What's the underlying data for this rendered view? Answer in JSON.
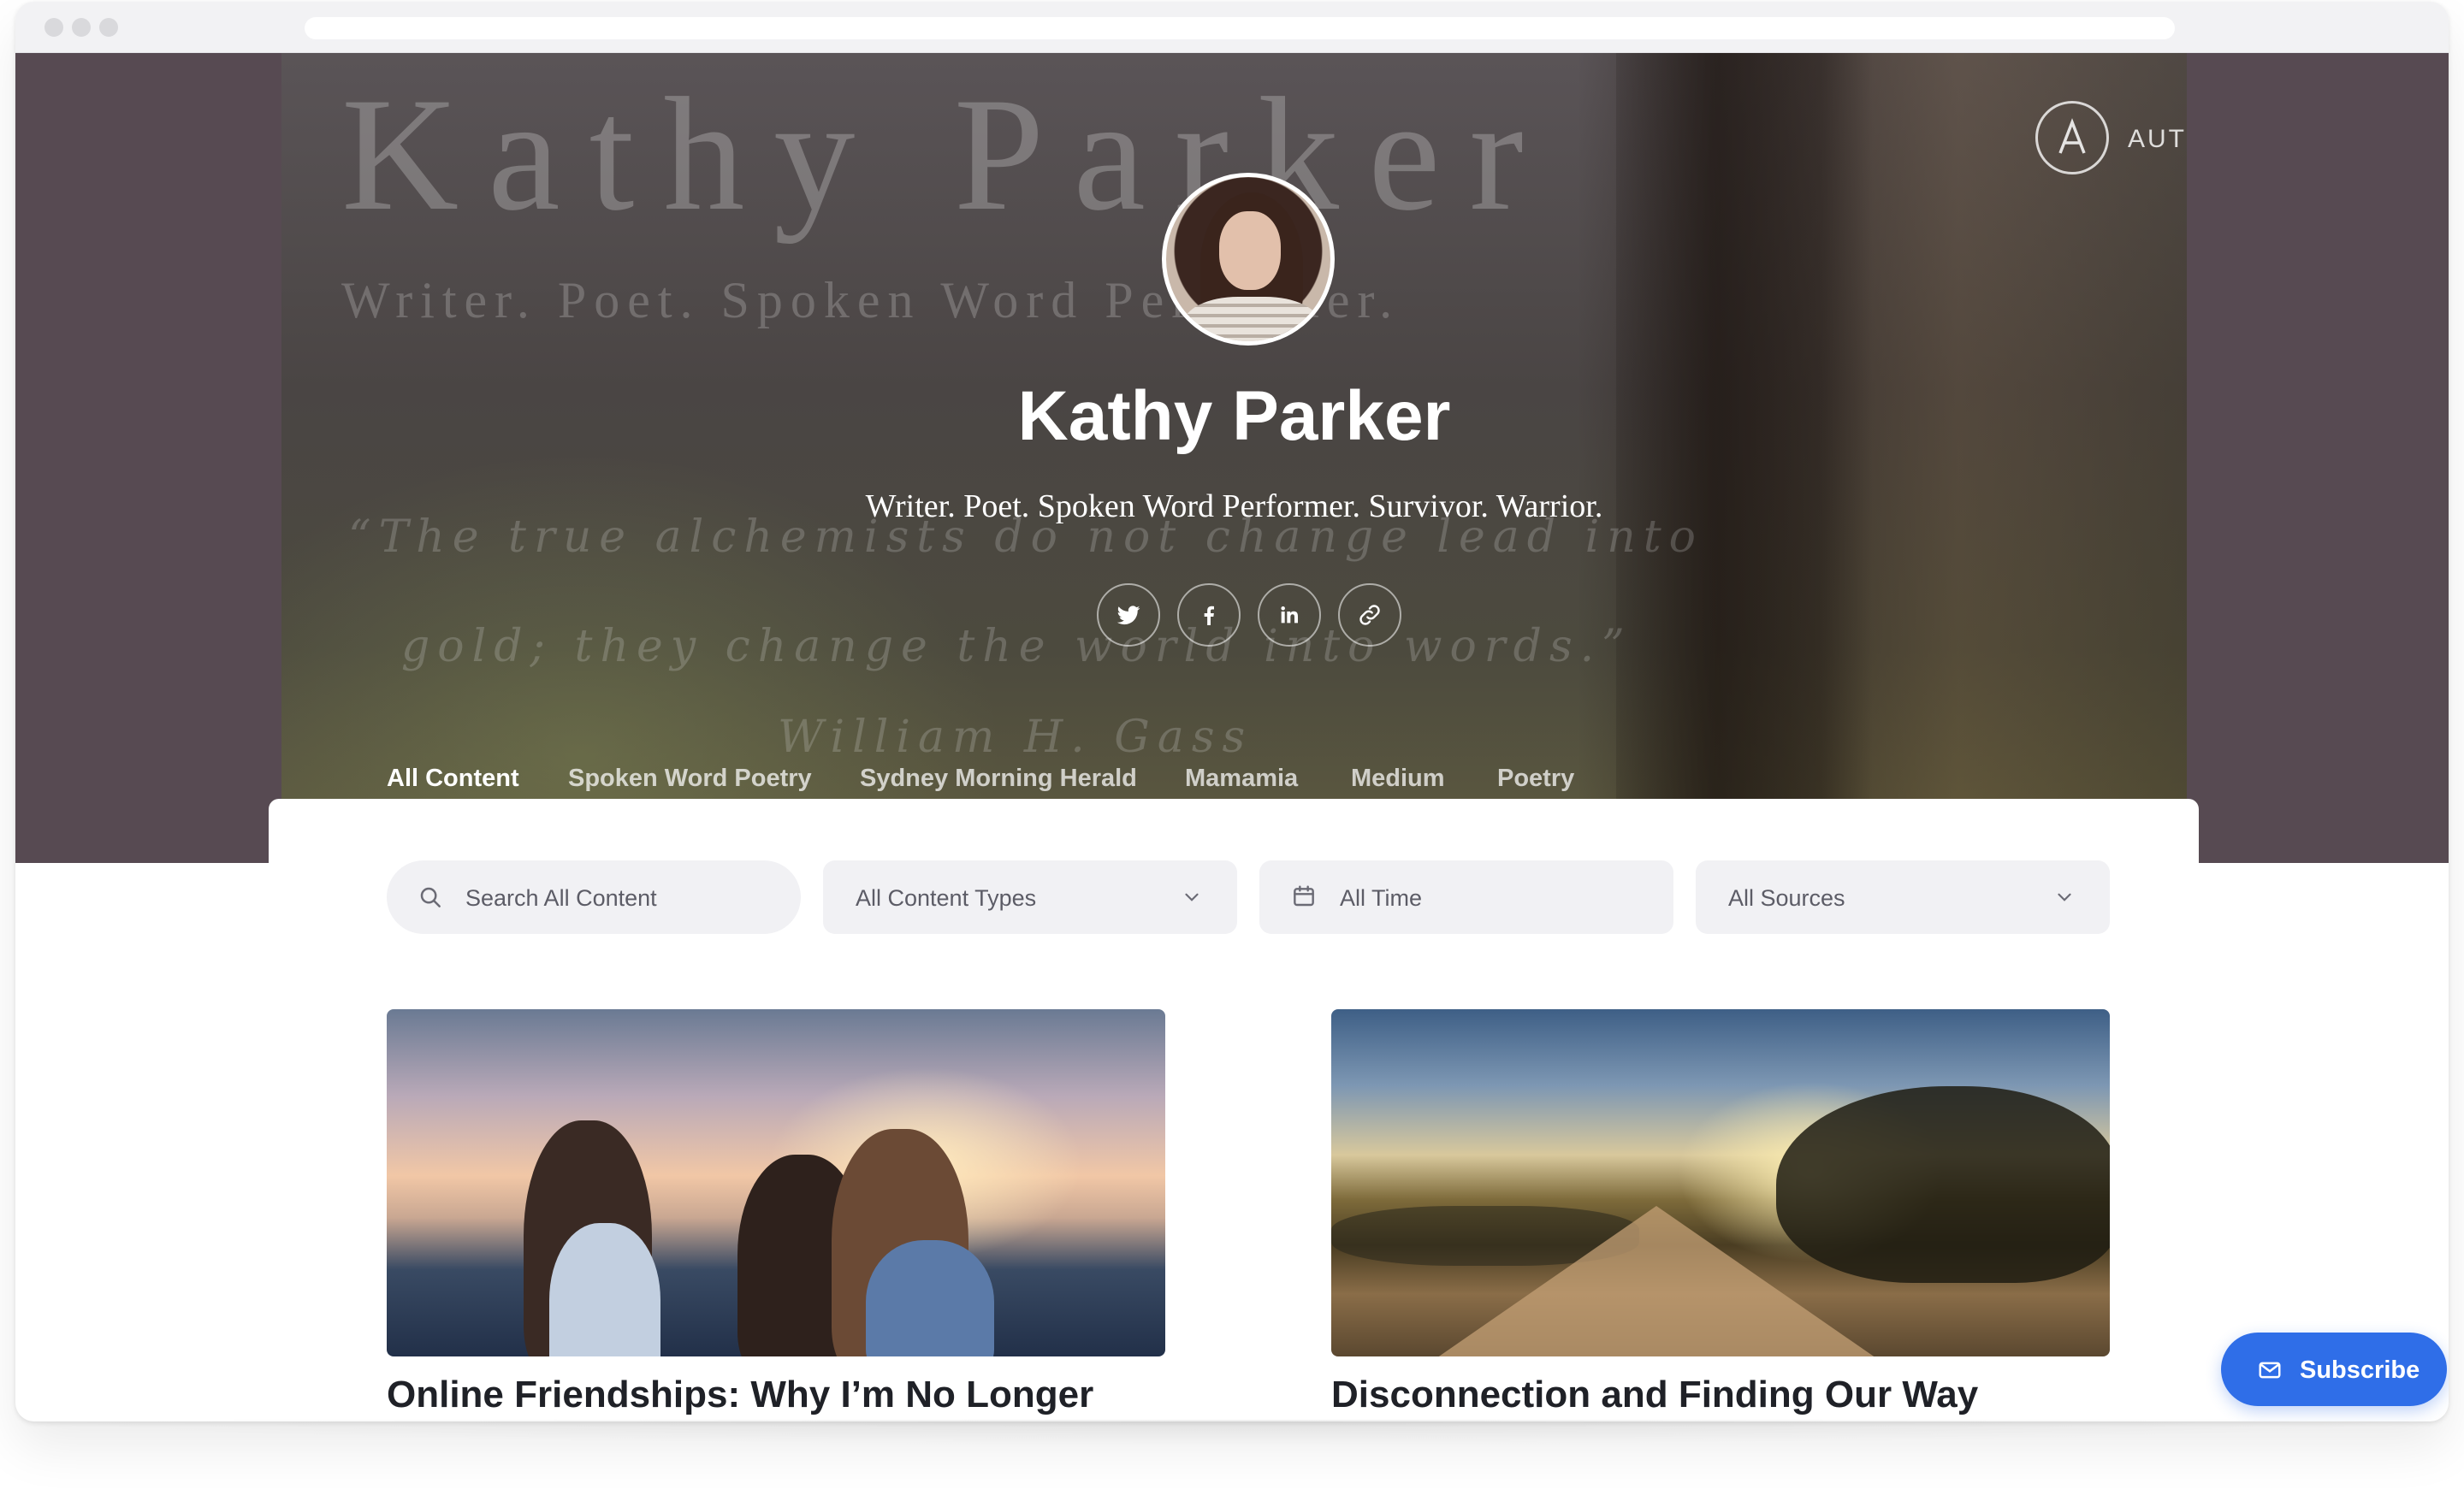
{
  "hero": {
    "background_name": "Kathy Parker",
    "background_tagline": "Writer. Poet. Spoken Word Performer.",
    "background_quote_line1": "“The true alchemists do not change lead into",
    "background_quote_line2": "gold; they change the world into words.”",
    "background_quote_author": "William H. Gass",
    "name": "Kathy Parker",
    "tagline": "Writer. Poet. Spoken Word Performer. Survivor. Warrior.",
    "brand": "AUTHORY",
    "socials": [
      {
        "icon": "twitter-icon"
      },
      {
        "icon": "facebook-icon"
      },
      {
        "icon": "linkedin-icon"
      },
      {
        "icon": "link-icon"
      }
    ]
  },
  "tabs": [
    {
      "label": "All Content",
      "active": true
    },
    {
      "label": "Spoken Word Poetry"
    },
    {
      "label": "Sydney Morning Herald"
    },
    {
      "label": "Mamamia"
    },
    {
      "label": "Medium"
    },
    {
      "label": "Poetry"
    }
  ],
  "filters": {
    "search_placeholder": "Search All Content",
    "content_types": "All Content Types",
    "time": "All Time",
    "sources": "All Sources"
  },
  "articles": [
    {
      "title": "Online Friendships: Why I’m No Longer"
    },
    {
      "title": "Disconnection and Finding Our Way"
    }
  ],
  "subscribe_label": "Subscribe",
  "colors": {
    "accent": "#2f6ee8",
    "hero_side": "#574a52"
  }
}
